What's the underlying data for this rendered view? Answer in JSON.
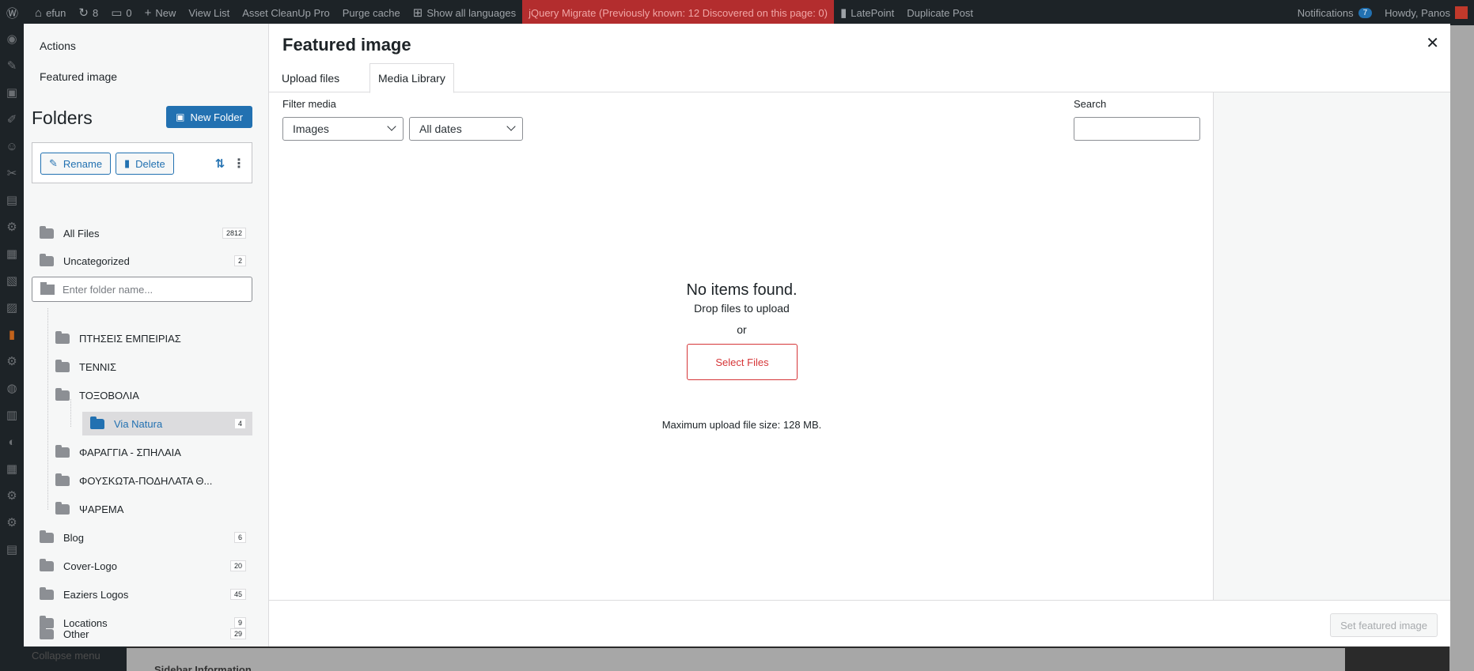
{
  "admin_bar": {
    "site_name": "efun",
    "updates_count": "8",
    "comments_count": "0",
    "new_label": "New",
    "view_list": "View List",
    "asset_cleanup": "Asset CleanUp Pro",
    "purge_cache": "Purge cache",
    "show_languages": "Show all languages",
    "jquery_migrate": "jQuery Migrate (Previously known: 12 Discovered on this page: 0)",
    "latepoint": "LatePoint",
    "duplicate_post": "Duplicate Post",
    "notifications": "Notifications",
    "notifications_count": "7",
    "howdy": "Howdy, Panos"
  },
  "background": {
    "collapse_menu": "Collapse menu",
    "sidebar_information": "Sidebar Information"
  },
  "modal": {
    "actions_label": "Actions",
    "featured_image_label": "Featured image",
    "title": "Featured image",
    "close_icon": "close-icon",
    "tabs": [
      {
        "label": "Upload files",
        "active": false
      },
      {
        "label": "Media Library",
        "active": true
      }
    ],
    "filter_label": "Filter media",
    "type_filter": "Images",
    "date_filter": "All dates",
    "search_label": "Search",
    "empty": {
      "title": "No items found.",
      "drop": "Drop files to upload",
      "or": "or",
      "select_files": "Select Files",
      "max_size": "Maximum upload file size: 128 MB."
    },
    "set_featured_button": "Set featured image"
  },
  "folders": {
    "title": "Folders",
    "new_folder": "New Folder",
    "rename": "Rename",
    "delete": "Delete",
    "search_placeholder": "Enter folder name...",
    "all_files": {
      "label": "All Files",
      "count": "2812"
    },
    "uncategorized": {
      "label": "Uncategorized",
      "count": "2"
    },
    "subfolders": [
      {
        "label": "ΠΤΗΣΕΙΣ ΕΜΠΕΙΡΙΑΣ"
      },
      {
        "label": "ΤΕΝΝΙΣ"
      },
      {
        "label": "ΤΟΞΟΒΟΛΙΑ"
      },
      {
        "label": "Via Natura",
        "count": "4",
        "active": true
      },
      {
        "label": "ΦΑΡΑΓΓΙΑ - ΣΠΗΛΑΙΑ"
      },
      {
        "label": "ΦΟΥΣΚΩΤΑ-ΠΟΔΗΛΑΤΑ Θ..."
      },
      {
        "label": "ΨΑΡΕΜΑ"
      }
    ],
    "top_level": [
      {
        "label": "Blog",
        "count": "6"
      },
      {
        "label": "Cover-Logo",
        "count": "20"
      },
      {
        "label": "Eaziers Logos",
        "count": "45"
      },
      {
        "label": "Locations",
        "count": "9"
      },
      {
        "label": "Other",
        "count": "29"
      }
    ]
  },
  "colors": {
    "primary": "#2271b1",
    "admin_bar": "#1d2327",
    "danger": "#d63638"
  }
}
